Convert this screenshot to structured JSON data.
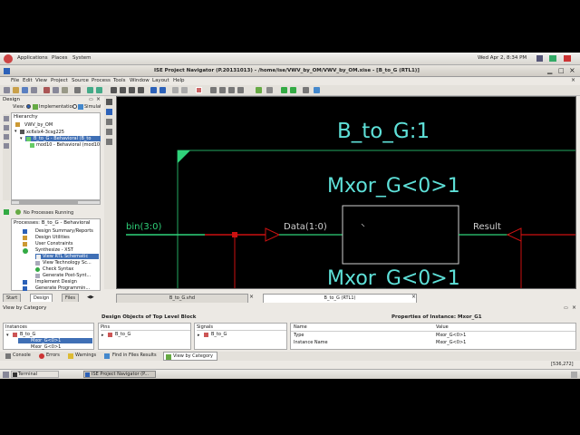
{
  "desktop": {
    "applications": "Applications",
    "places": "Places",
    "system": "System",
    "clock": "Wed Apr  2,  8:34 PM"
  },
  "window": {
    "title": "ISE Project Navigator (P.20131013) - /home/ise/VWV_by_OM/VWV_by_OM.xise - [B_to_G (RTL1)]"
  },
  "menu": [
    "File",
    "Edit",
    "View",
    "Project",
    "Source",
    "Process",
    "Tools",
    "Window",
    "Layout",
    "Help"
  ],
  "design_panel": {
    "title": "Design",
    "view_label": "View:",
    "view_options": [
      "Implementation",
      "Simulation"
    ],
    "hierarchy_label": "Hierarchy",
    "tree": [
      "VWV_by_OM",
      "xc6slx4-3csg225",
      "B_to_G - Behavioral (B_to",
      "mod10 - Behavioral (mod10"
    ],
    "no_processes": "No Processes Running",
    "processes_label": "Processes: B_to_G - Behavioral",
    "processes": [
      "Design Summary/Reports",
      "Design Utilities",
      "User Constraints",
      "Synthesize - XST",
      "View RTL Schematic",
      "View Technology Sc...",
      "Check Syntax",
      "Generate Post-Synt...",
      "Implement Design",
      "Generate Programmin..."
    ]
  },
  "left_tabs": [
    "Start",
    "Design",
    "Files"
  ],
  "schematic": {
    "top_label": "B_to_G:1",
    "block_label_top": "Mxor_G<0>1",
    "block_label_bottom": "Mxor_G<0>1",
    "input_port": "bin(3:0)",
    "pin_in": "Data(1:0)",
    "pin_out": "Result"
  },
  "editor_tabs": [
    "B_to_G.vhd",
    "B_to_G (RTL1)"
  ],
  "bottom": {
    "view_by_category": "View by Category",
    "design_objects_title": "Design Objects of Top Level Block",
    "properties_title": "Properties of Instance: Mxor_G1",
    "instances_header": "Instances",
    "instances": [
      "B_to_G",
      "Mxor_G<0>1",
      "Mxor_G<0>1"
    ],
    "pins_header": "Pins",
    "pins": [
      "B_to_G"
    ],
    "signals_header": "Signals",
    "signals": [
      "B_to_G"
    ],
    "prop_headers": [
      "Name",
      "Value"
    ],
    "props": [
      [
        "Type",
        "Mxor_G<0>1"
      ],
      [
        "Instance Name",
        "Mxor_G<0>1"
      ]
    ]
  },
  "console_tabs": [
    "Console",
    "Errors",
    "Warnings",
    "Find in Files Results",
    "View by Category"
  ],
  "status": {
    "coords": "[536,272]"
  },
  "taskbar": [
    "Terminal",
    "ISE Project Navigator (P..."
  ],
  "colors": {
    "schematic_bg": "#000000",
    "label": "#5ee0d8",
    "wire": "#2fd27a",
    "net_red": "#cc1111",
    "block": "#cfcfcf"
  }
}
